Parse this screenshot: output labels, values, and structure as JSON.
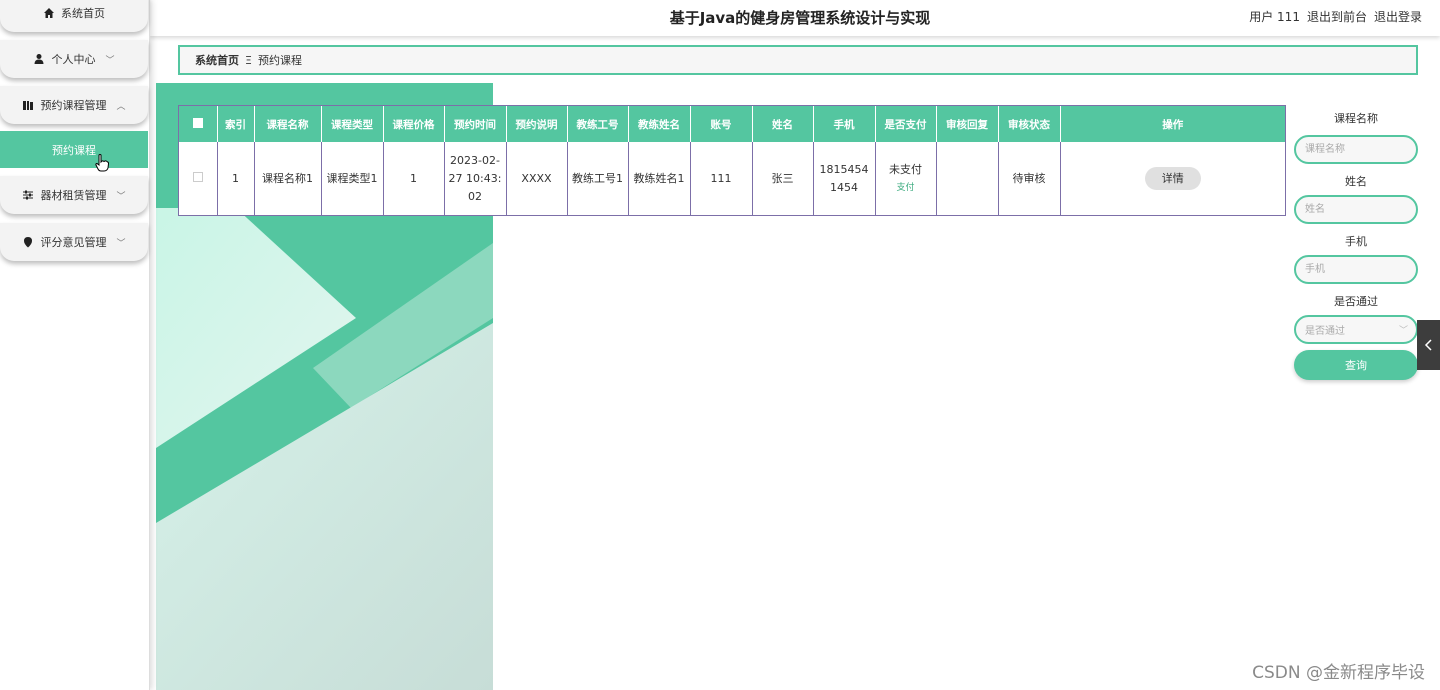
{
  "header": {
    "title": "基于Java的健身房管理系统设计与实现",
    "user_label": "用户 111",
    "back_front": "退出到前台",
    "logout": "退出登录"
  },
  "sidebar": {
    "items": [
      {
        "label": "系统首页",
        "icon": "home-icon"
      },
      {
        "label": "个人中心",
        "icon": "user-icon"
      },
      {
        "label": "预约课程管理",
        "icon": "book-icon"
      },
      {
        "label": "器材租赁管理",
        "icon": "sliders-icon"
      },
      {
        "label": "评分意见管理",
        "icon": "location-pin-icon"
      }
    ],
    "sub_active": "预约课程"
  },
  "breadcrumb": {
    "home": "系统首页",
    "separator": "Ξ",
    "current": "预约课程"
  },
  "table": {
    "headers": [
      "索引",
      "课程名称",
      "课程类型",
      "课程价格",
      "预约时间",
      "预约说明",
      "教练工号",
      "教练姓名",
      "账号",
      "姓名",
      "手机",
      "是否支付",
      "审核回复",
      "审核状态",
      "操作"
    ],
    "rows": [
      {
        "index": "1",
        "course_name": "课程名称1",
        "course_type": "课程类型1",
        "price": "1",
        "time": "2023-02-27 10:43:02",
        "desc": "XXXX",
        "coach_id": "教练工号1",
        "coach_name": "教练姓名1",
        "account": "111",
        "name": "张三",
        "phone": "18154541454",
        "paid": "未支付",
        "pay_link": "支付",
        "reply": "",
        "status": "待审核",
        "action": "详情"
      }
    ]
  },
  "search": {
    "course_label": "课程名称",
    "course_placeholder": "课程名称",
    "name_label": "姓名",
    "name_placeholder": "姓名",
    "phone_label": "手机",
    "phone_placeholder": "手机",
    "pass_label": "是否通过",
    "pass_placeholder": "是否通过",
    "query_button": "查询"
  },
  "watermark": "CSDN @金新程序毕设",
  "colors": {
    "accent": "#54c6a0",
    "table_border": "#7c6fa8",
    "toggle": "#3d3d3d"
  }
}
